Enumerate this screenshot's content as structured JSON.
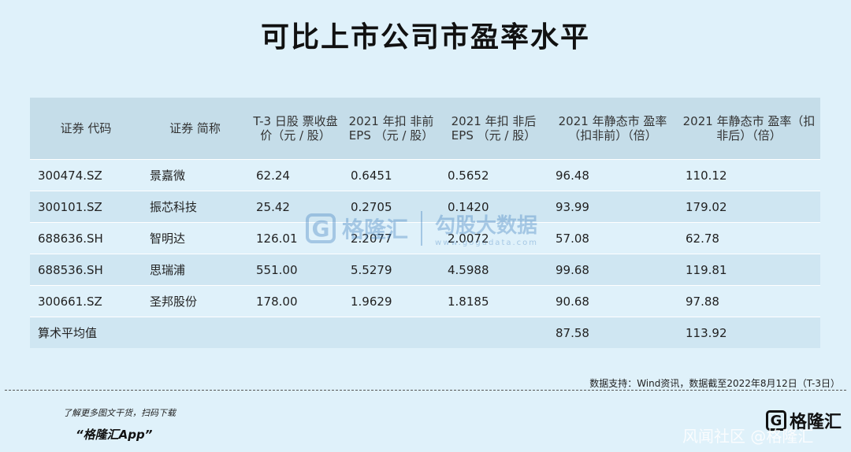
{
  "title": "可比上市公司市盈率水平",
  "table": {
    "headers": [
      "证券 代码",
      "证券 简称",
      "T-3 日股 票收盘价（元 / 股）",
      "2021 年扣 非前 EPS （元 / 股）",
      "2021 年扣 非后 EPS （元 / 股）",
      "2021 年静态市 盈率（扣非前）（倍）",
      "2021 年静态市 盈率（扣非后）（倍）"
    ],
    "rows": [
      [
        "300474.SZ",
        "景嘉微",
        "62.24",
        "0.6451",
        "0.5652",
        "96.48",
        "110.12"
      ],
      [
        "300101.SZ",
        "振芯科技",
        "25.42",
        "0.2705",
        "0.1420",
        "93.99",
        "179.02"
      ],
      [
        "688636.SH",
        "智明达",
        "126.01",
        "2.2077",
        "2.0072",
        "57.08",
        "62.78"
      ],
      [
        "688536.SH",
        "思瑞浦",
        "551.00",
        "5.5279",
        "4.5988",
        "99.68",
        "119.81"
      ],
      [
        "300661.SZ",
        "圣邦股份",
        "178.00",
        "1.9629",
        "1.8185",
        "90.68",
        "97.88"
      ],
      [
        "算术平均值",
        "",
        "",
        "",
        "",
        "87.58",
        "113.92"
      ]
    ]
  },
  "watermark": {
    "logo": "G",
    "brand": "格隆汇",
    "right_big": "勾股大数据",
    "right_small": "www.gogudata.com"
  },
  "source": "数据支持：Wind资讯，数据截至2022年8月12日（T-3日）",
  "footer": {
    "note": "了解更多图文干货，扫码下载",
    "app": "“格隆汇App”",
    "brand_logo": "G",
    "brand_text": "格隆汇",
    "corner": "风闻社区 @格隆汇"
  }
}
